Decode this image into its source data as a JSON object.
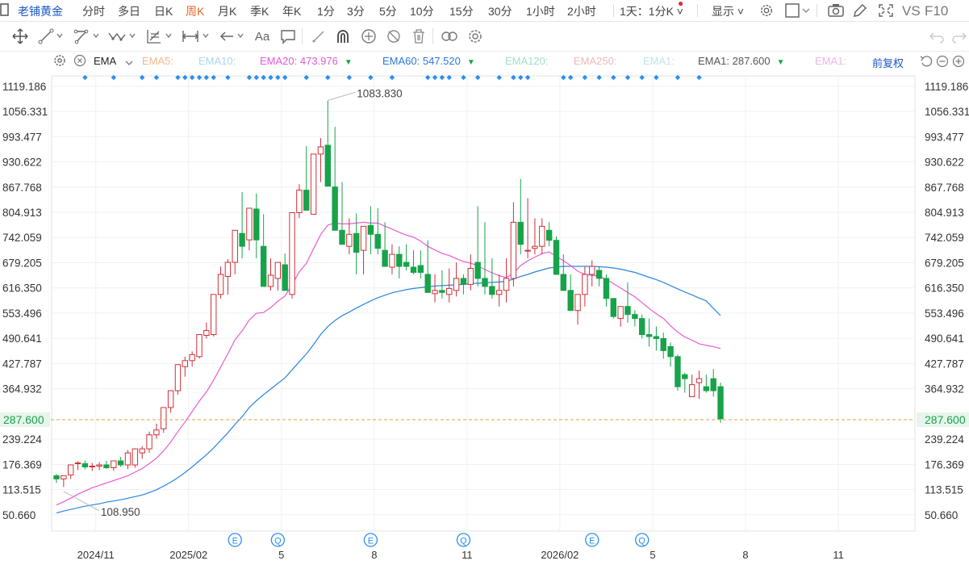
{
  "toolbar_top": {
    "name": "老铺黄金",
    "periods": [
      "分时",
      "多日",
      "日K",
      "周K",
      "月K",
      "季K",
      "年K",
      "1分",
      "3分",
      "5分",
      "10分",
      "15分",
      "30分",
      "1小时",
      "2小时"
    ],
    "active_period": "周K",
    "combo": "1天：1分K",
    "display": "显示",
    "vs": "VS",
    "f10": "F10"
  },
  "indicator_bar": {
    "indicator": "EMA",
    "items": [
      {
        "label": "EMA5:",
        "value": "",
        "color": "#f6b88a"
      },
      {
        "label": "EMA10:",
        "value": "",
        "color": "#a8d8ec"
      },
      {
        "label": "EMA20:",
        "value": "473.976",
        "color": "#e25ad6",
        "arrow": "▼",
        "arrow_color": "#1aa34a"
      },
      {
        "label": "EMA60:",
        "value": "547.520",
        "color": "#2a78d8",
        "arrow": "▼",
        "arrow_color": "#1aa34a"
      },
      {
        "label": "EMA120:",
        "value": "",
        "color": "#9fe0c4"
      },
      {
        "label": "EMA250:",
        "value": "",
        "color": "#f3b9b2"
      },
      {
        "label": "EMA1:",
        "value": "",
        "color": "#b9e3f0"
      },
      {
        "label": "EMA1:",
        "value": "287.600",
        "color": "#555555",
        "arrow": "▼",
        "arrow_color": "#1aa34a"
      },
      {
        "label": "EMA1:",
        "value": "",
        "color": "#e9b6ea"
      }
    ],
    "adjust": "前复权"
  },
  "colors": {
    "up": "#cf2f37",
    "down": "#17a34a",
    "ema20": "#e95bd1",
    "ema60": "#2a86e0",
    "last": "#e0a040",
    "grid": "#eef0f4",
    "marker": "#2b8ff0",
    "last_box": "#e7f5ec",
    "last_text": "#17a34a"
  },
  "chart_data": {
    "type": "candlestick",
    "y_ticks": [
      "1119.186",
      "1056.331",
      "993.477",
      "930.622",
      "867.768",
      "804.913",
      "742.059",
      "679.205",
      "616.350",
      "553.496",
      "490.641",
      "427.787",
      "364.932",
      "239.224",
      "176.369",
      "113.515",
      "50.660"
    ],
    "y_tick_values": [
      1119.186,
      1056.331,
      993.477,
      930.622,
      867.768,
      804.913,
      742.059,
      679.205,
      616.35,
      553.496,
      490.641,
      427.787,
      364.932,
      239.224,
      176.369,
      113.515,
      50.66
    ],
    "ylim": [
      10,
      1145
    ],
    "x_ticks": [
      "2024/11",
      "2025/02",
      "5",
      "8",
      "11",
      "2026/02",
      "5",
      "8",
      "11"
    ],
    "x_tick_index": [
      5.5,
      18.5,
      31.5,
      44.5,
      57.5,
      70.5,
      83.5,
      96.5,
      109.5
    ],
    "last_price": 287.6,
    "last_price_label": "287.600",
    "max_label": "1083.830",
    "min_label": "108.950",
    "max_value": 1083.83,
    "min_value": 108.95,
    "max_index": 38,
    "min_index": 1,
    "events": [
      {
        "index": 25,
        "letter": "E"
      },
      {
        "index": 31,
        "letter": "Q"
      },
      {
        "index": 44,
        "letter": "E"
      },
      {
        "index": 57,
        "letter": "Q"
      },
      {
        "index": 75,
        "letter": "E"
      },
      {
        "index": 82,
        "letter": "Q"
      }
    ],
    "marker_index": [
      4,
      8,
      12,
      14,
      17,
      18,
      19,
      20,
      21,
      22,
      24,
      27,
      28,
      29,
      30,
      31,
      32,
      35,
      38,
      41,
      44,
      47,
      52,
      53,
      54,
      55,
      57,
      59,
      62,
      64,
      65,
      66,
      71,
      72,
      74,
      76,
      78,
      80,
      82,
      84,
      87,
      90
    ],
    "open": [
      148,
      140,
      150,
      178,
      178,
      170,
      172,
      175,
      168,
      185,
      175,
      175,
      205,
      215,
      250,
      265,
      318,
      360,
      420,
      435,
      445,
      498,
      500,
      600,
      645,
      680,
      752,
      736,
      813,
      720,
      620,
      640,
      674,
      600,
      804,
      860,
      800,
      950,
      972,
      868,
      760,
      720,
      752,
      710,
      772,
      750,
      710,
      668,
      700,
      680,
      668,
      672,
      650,
      602,
      610,
      600,
      610,
      640,
      625,
      680,
      640,
      620,
      600,
      610,
      640,
      780,
      710,
      715,
      720,
      760,
      735,
      650,
      610,
      560,
      600,
      650,
      660,
      640,
      590,
      540,
      570,
      550,
      540,
      500,
      495,
      490,
      470,
      445,
      400,
      345,
      380,
      370,
      390,
      370
    ],
    "high": [
      152,
      145,
      165,
      184,
      186,
      180,
      182,
      185,
      182,
      195,
      212,
      216,
      222,
      258,
      278,
      292,
      332,
      388,
      445,
      458,
      498,
      530,
      600,
      670,
      688,
      745,
      855,
      776,
      852,
      800,
      690,
      680,
      702,
      740,
      875,
      970,
      940,
      990,
      1083,
      1018,
      880,
      790,
      802,
      760,
      820,
      815,
      780,
      725,
      720,
      725,
      710,
      710,
      735,
      650,
      660,
      665,
      680,
      650,
      700,
      820,
      780,
      690,
      650,
      690,
      830,
      888,
      840,
      790,
      790,
      780,
      745,
      700,
      650,
      600,
      670,
      685,
      670,
      650,
      590,
      570,
      630,
      560,
      550,
      540,
      520,
      505,
      480,
      450,
      405,
      400,
      410,
      400,
      414,
      380
    ],
    "low": [
      130,
      120,
      140,
      162,
      164,
      160,
      162,
      165,
      160,
      170,
      165,
      168,
      190,
      205,
      240,
      255,
      305,
      350,
      395,
      420,
      440,
      490,
      495,
      590,
      600,
      650,
      690,
      710,
      690,
      630,
      610,
      610,
      620,
      590,
      790,
      840,
      800,
      880,
      950,
      860,
      760,
      700,
      650,
      650,
      700,
      700,
      680,
      650,
      640,
      660,
      650,
      640,
      640,
      580,
      590,
      580,
      595,
      600,
      610,
      620,
      600,
      590,
      570,
      580,
      620,
      700,
      690,
      700,
      700,
      720,
      690,
      620,
      560,
      525,
      570,
      620,
      620,
      570,
      540,
      520,
      530,
      520,
      490,
      470,
      460,
      440,
      420,
      360,
      355,
      345,
      340,
      355,
      345,
      280
    ],
    "close": [
      140,
      148,
      175,
      180,
      170,
      172,
      175,
      168,
      185,
      175,
      205,
      215,
      215,
      250,
      262,
      318,
      360,
      425,
      435,
      450,
      500,
      510,
      600,
      650,
      680,
      760,
      720,
      815,
      736,
      620,
      648,
      680,
      610,
      804,
      860,
      810,
      950,
      968,
      870,
      760,
      725,
      750,
      705,
      770,
      750,
      715,
      670,
      700,
      670,
      670,
      655,
      655,
      605,
      610,
      605,
      615,
      640,
      625,
      665,
      640,
      620,
      600,
      610,
      640,
      780,
      725,
      710,
      720,
      770,
      735,
      650,
      610,
      560,
      600,
      650,
      670,
      640,
      590,
      545,
      570,
      550,
      540,
      500,
      495,
      490,
      460,
      445,
      370,
      390,
      375,
      390,
      360,
      360,
      290
    ],
    "ema20": [
      75,
      83,
      92,
      102,
      110,
      118,
      124,
      130,
      136,
      142,
      148,
      157,
      166,
      178,
      192,
      210,
      232,
      258,
      282,
      308,
      334,
      357,
      386,
      419,
      452,
      487,
      509,
      536,
      553,
      555,
      567,
      583,
      596,
      625,
      656,
      678,
      714,
      749,
      773,
      778,
      776,
      776,
      778,
      780,
      778,
      778,
      770,
      763,
      755,
      748,
      743,
      733,
      720,
      711,
      702,
      697,
      689,
      682,
      678,
      672,
      662,
      654,
      647,
      642,
      652,
      672,
      684,
      693,
      702,
      706,
      695,
      684,
      672,
      658,
      650,
      648,
      645,
      638,
      627,
      616,
      605,
      594,
      580,
      565,
      552,
      540,
      522,
      506,
      494,
      486,
      477,
      473,
      470,
      465
    ],
    "ema60": [
      55,
      60,
      64,
      68,
      72,
      75,
      78,
      82,
      85,
      88,
      92,
      96,
      100,
      106,
      113,
      122,
      132,
      143,
      156,
      170,
      185,
      200,
      217,
      236,
      255,
      276,
      295,
      318,
      335,
      350,
      364,
      378,
      392,
      412,
      432,
      452,
      475,
      500,
      520,
      535,
      547,
      556,
      566,
      575,
      584,
      592,
      598,
      604,
      608,
      612,
      615,
      617,
      619,
      621,
      622,
      623,
      624,
      625,
      627,
      628,
      629,
      630,
      631,
      633,
      638,
      645,
      650,
      656,
      661,
      666,
      668,
      670,
      670,
      670,
      670,
      670,
      669,
      668,
      666,
      663,
      659,
      655,
      649,
      643,
      637,
      630,
      622,
      614,
      606,
      599,
      591,
      584,
      565,
      547.52
    ]
  }
}
